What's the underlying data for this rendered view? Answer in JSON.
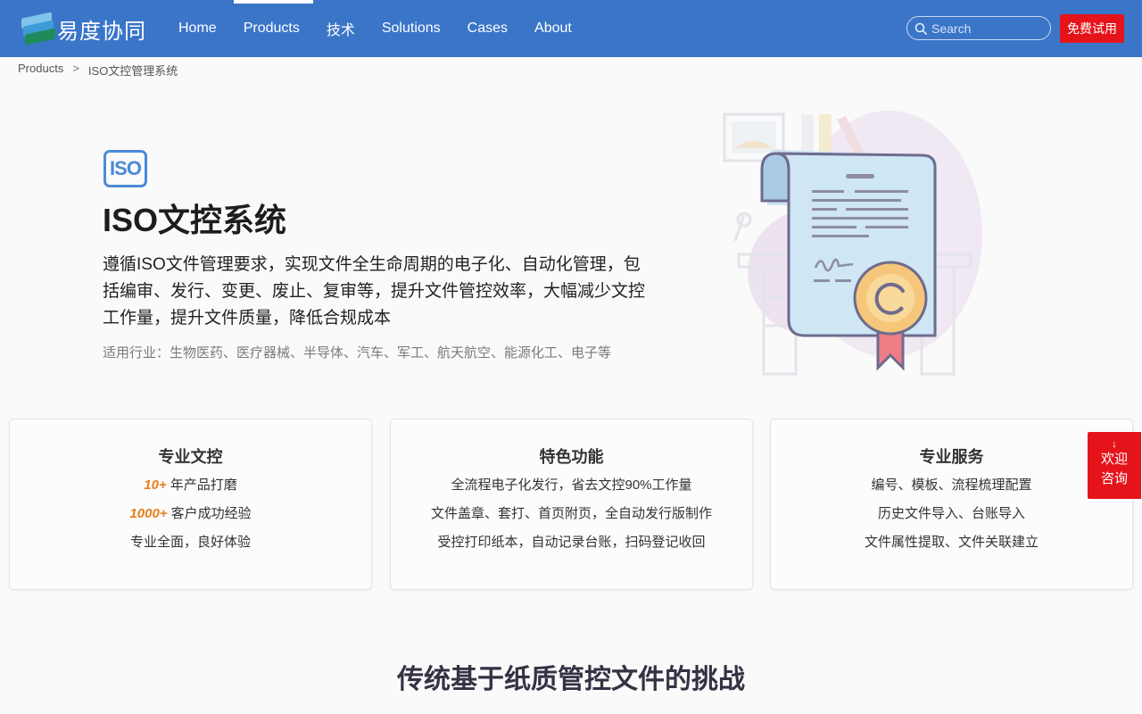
{
  "header": {
    "logo_text": "易度协同",
    "nav": [
      {
        "label": "Home",
        "active": false
      },
      {
        "label": "Products",
        "active": true
      },
      {
        "label": "技术",
        "active": false
      },
      {
        "label": "Solutions",
        "active": false
      },
      {
        "label": "Cases",
        "active": false
      },
      {
        "label": "About",
        "active": false
      }
    ],
    "search_placeholder": "Search",
    "trial_label": "免费试用"
  },
  "breadcrumb": {
    "parent": "Products",
    "separator": ">",
    "current": "ISO文控管理系统"
  },
  "hero": {
    "badge": "ISO",
    "title": "ISO文控系统",
    "description": "遵循ISO文件管理要求，实现文件全生命周期的电子化、自动化管理，包括编审、发行、变更、废止、复审等，提升文件管控效率，大幅减少文控工作量，提升文件质量，降低合规成本",
    "industries": "适用行业：生物医药、医疗器械、半导体、汽车、军工、航天航空、能源化工、电子等"
  },
  "cards": [
    {
      "title": "专业文控",
      "rows": [
        {
          "highlight": "10+",
          "text": "年产品打磨"
        },
        {
          "highlight": "1000+",
          "text": "客户成功经验"
        },
        {
          "highlight": "",
          "text": "专业全面，良好体验"
        }
      ]
    },
    {
      "title": "特色功能",
      "rows": [
        {
          "highlight": "",
          "text": "全流程电子化发行，省去文控90%工作量"
        },
        {
          "highlight": "",
          "text": "文件盖章、套打、首页附页，全自动发行版制作"
        },
        {
          "highlight": "",
          "text": "受控打印纸本，自动记录台账，扫码登记收回"
        }
      ]
    },
    {
      "title": "专业服务",
      "rows": [
        {
          "highlight": "",
          "text": "编号、模板、流程梳理配置"
        },
        {
          "highlight": "",
          "text": "历史文件导入、台账导入"
        },
        {
          "highlight": "",
          "text": "文件属性提取、文件关联建立"
        }
      ]
    }
  ],
  "consult": {
    "line1": "欢迎",
    "line2": "咨询"
  },
  "section": {
    "title": "传统基于纸质管控文件的挑战"
  },
  "colors": {
    "header_bg": "#3a75c8",
    "accent_red": "#e5141b",
    "highlight_orange": "#e77e1e",
    "iso_blue": "#4b8ad6"
  },
  "icons": [
    "search-icon",
    "chevron-double-down-icon",
    "certificate-illustration"
  ]
}
